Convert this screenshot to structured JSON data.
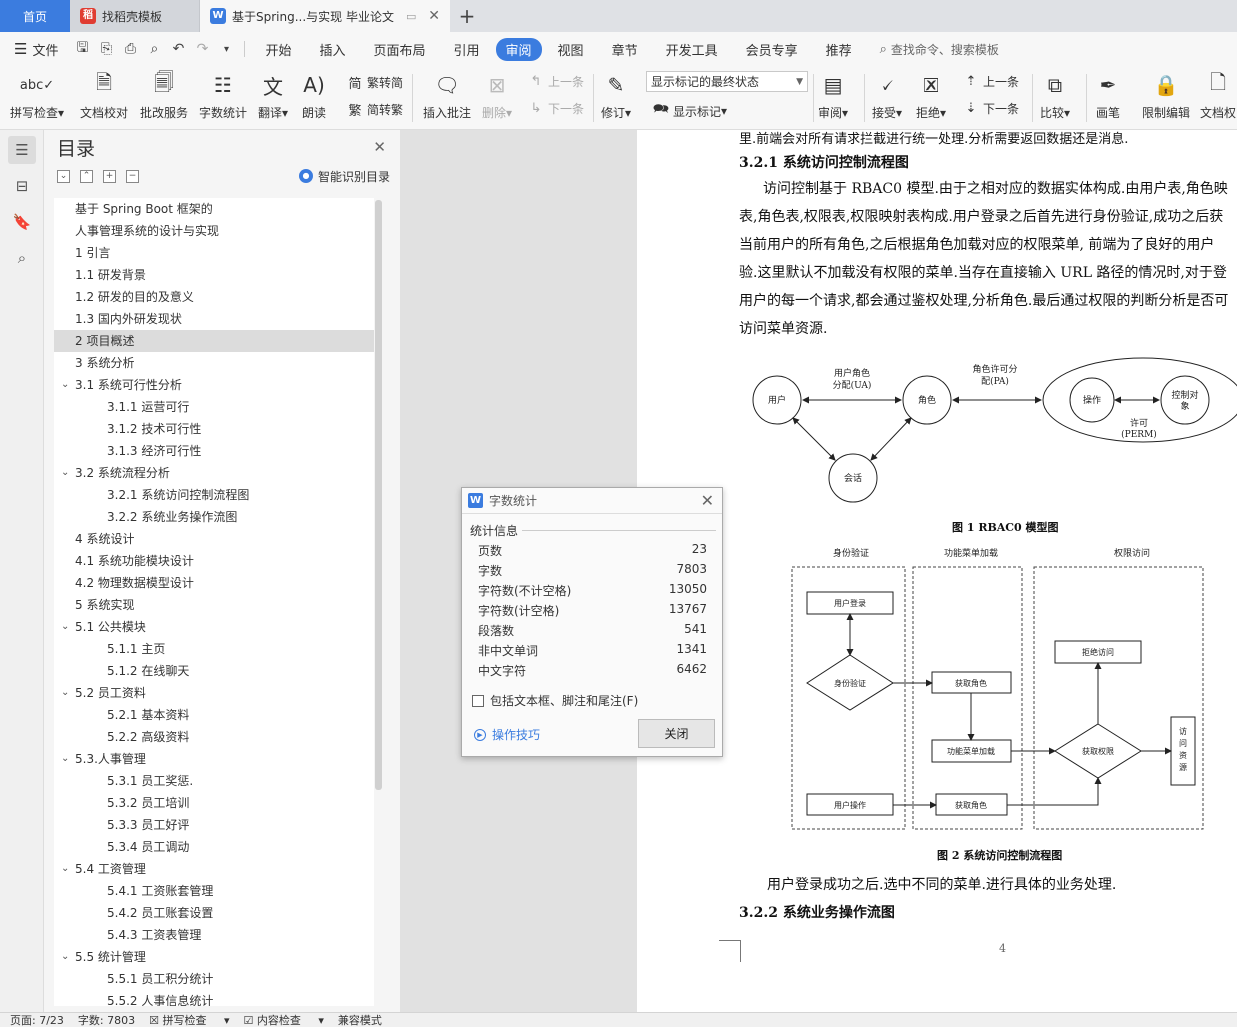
{
  "tabs": {
    "home": "首页",
    "template": "找稻壳模板",
    "active": "基于Spring...与实现 毕业论文",
    "new_tab": "+"
  },
  "menu": {
    "file": "文件",
    "items": [
      "开始",
      "插入",
      "页面布局",
      "引用",
      "审阅",
      "视图",
      "章节",
      "开发工具",
      "会员专享",
      "推荐"
    ],
    "active_index": 4,
    "search": "查找命令、搜索模板"
  },
  "ribbon": {
    "spell_check": "拼写检查",
    "doc_proof": "文档校对",
    "batch_service": "批改服务",
    "word_count": "字数统计",
    "translate": "翻译",
    "read_aloud": "朗读",
    "trad_to_simp": "繁转简",
    "simp_to_trad": "简转繁",
    "insert_comment": "插入批注",
    "delete": "删除",
    "prev_comment": "上一条",
    "next_comment": "下一条",
    "track_changes": "修订",
    "markup_state": "显示标记的最终状态",
    "show_markup": "显示标记",
    "review": "审阅",
    "accept": "接受",
    "reject": "拒绝",
    "prev": "上一条",
    "next": "下一条",
    "compare": "比较",
    "ink": "画笔",
    "restrict_edit": "限制编辑",
    "doc_perm": "文档权"
  },
  "nav": {
    "title": "目录",
    "smart": "智能识别目录",
    "selected_index": 6,
    "items": [
      {
        "label": "基于 Spring Boot 框架的",
        "level": 0,
        "chev": ""
      },
      {
        "label": "人事管理系统的设计与实现",
        "level": 0,
        "chev": ""
      },
      {
        "label": "1 引言",
        "level": 0,
        "chev": ""
      },
      {
        "label": "1.1 研发背景",
        "level": 0,
        "chev": ""
      },
      {
        "label": "1.2 研发的目的及意义",
        "level": 0,
        "chev": ""
      },
      {
        "label": "1.3 国内外研发现状",
        "level": 0,
        "chev": ""
      },
      {
        "label": "2 项目概述",
        "level": 0,
        "chev": ""
      },
      {
        "label": "3 系统分析",
        "level": 0,
        "chev": ""
      },
      {
        "label": "3.1 系统可行性分析",
        "level": 0,
        "chev": "v"
      },
      {
        "label": "3.1.1 运营可行",
        "level": 1,
        "chev": ""
      },
      {
        "label": "3.1.2 技术可行性",
        "level": 1,
        "chev": ""
      },
      {
        "label": "3.1.3 经济可行性",
        "level": 1,
        "chev": ""
      },
      {
        "label": "3.2 系统流程分析",
        "level": 0,
        "chev": "v"
      },
      {
        "label": "3.2.1 系统访问控制流程图",
        "level": 1,
        "chev": ""
      },
      {
        "label": "3.2.2 系统业务操作流图",
        "level": 1,
        "chev": ""
      },
      {
        "label": "4 系统设计",
        "level": 0,
        "chev": ""
      },
      {
        "label": "4.1 系统功能模块设计",
        "level": 0,
        "chev": ""
      },
      {
        "label": "4.2 物理数据模型设计",
        "level": 0,
        "chev": ""
      },
      {
        "label": "5 系统实现",
        "level": 0,
        "chev": ""
      },
      {
        "label": "5.1  公共模块",
        "level": 0,
        "chev": "v"
      },
      {
        "label": "5.1.1 主页",
        "level": 1,
        "chev": ""
      },
      {
        "label": "5.1.2 在线聊天",
        "level": 1,
        "chev": ""
      },
      {
        "label": "5.2  员工资料",
        "level": 0,
        "chev": "v"
      },
      {
        "label": "5.2.1 基本资料",
        "level": 1,
        "chev": ""
      },
      {
        "label": "5.2.2  高级资料",
        "level": 1,
        "chev": ""
      },
      {
        "label": "5.3.人事管理",
        "level": 0,
        "chev": "v"
      },
      {
        "label": "5.3.1 员工奖惩.",
        "level": 1,
        "chev": ""
      },
      {
        "label": "5.3.2 员工培训",
        "level": 1,
        "chev": ""
      },
      {
        "label": "5.3.3 员工好评",
        "level": 1,
        "chev": ""
      },
      {
        "label": "5.3.4 员工调动",
        "level": 1,
        "chev": ""
      },
      {
        "label": "5.4 工资管理",
        "level": 0,
        "chev": "v"
      },
      {
        "label": "5.4.1 工资账套管理",
        "level": 1,
        "chev": ""
      },
      {
        "label": "5.4.2 员工账套设置",
        "level": 1,
        "chev": ""
      },
      {
        "label": "5.4.3 工资表管理",
        "level": 1,
        "chev": ""
      },
      {
        "label": "5.5 统计管理",
        "level": 0,
        "chev": "v"
      },
      {
        "label": "5.5.1 员工积分统计",
        "level": 1,
        "chev": ""
      },
      {
        "label": "5.5.2 人事信息统计",
        "level": 1,
        "chev": ""
      }
    ]
  },
  "dialog": {
    "title": "字数统计",
    "section": "统计信息",
    "stats": [
      {
        "label": "页数",
        "value": "23"
      },
      {
        "label": "字数",
        "value": "7803"
      },
      {
        "label": "字符数(不计空格)",
        "value": "13050"
      },
      {
        "label": "字符数(计空格)",
        "value": "13767"
      },
      {
        "label": "段落数",
        "value": "541"
      },
      {
        "label": "非中文单词",
        "value": "1341"
      },
      {
        "label": "中文字符",
        "value": "6462"
      }
    ],
    "include_label": "包括文本框、脚注和尾注(F)",
    "include_checked": false,
    "tips": "操作技巧",
    "close": "关闭"
  },
  "doc": {
    "top_line": "里.前端会对所有请求拦截进行统一处理.分析需要返回数据还是消息.",
    "heading_321": "3.2.1 系统访问控制流程图",
    "para1_lines": [
      "访问控制基于 RBAC0 模型.由于之相对应的数据实体构成.由用户表,角色映",
      "表,角色表,权限表,权限映射表构成.用户登录之后首先进行身份验证,成功之后获",
      "当前用户的所有角色,之后根据角色加载对应的权限菜单, 前端为了良好的用户",
      "验.这里默认不加载没有权限的菜单.当存在直接输入 URL 路径的情况时,对于登",
      "用户的每一个请求,都会通过鉴权处理,分析角色.最后通过权限的判断分析是否可",
      "访问菜单资源."
    ],
    "fig1": {
      "caption": "图 1 RBAC0 模型图",
      "user": "用户",
      "role": "角色",
      "session": "会话",
      "ua_line1": "用户角色",
      "ua_line2": "分配(UA)",
      "pa_line1": "角色许可分",
      "pa_line2": "配(PA)",
      "operation": "操作",
      "control_line1": "控制对",
      "control_line2": "象",
      "perm_line1": "许可",
      "perm_line2": "(PERM)"
    },
    "fig2": {
      "caption": "图 2  系统访问控制流程图",
      "col1": "身份验证",
      "col2": "功能菜单加载",
      "col3": "权限访问",
      "user_login": "用户登录",
      "auth": "身份验证",
      "get_role": "获取角色",
      "load_menu": "功能菜单加载",
      "user_op": "用户操作",
      "get_role2": "获取角色",
      "deny": "拒绝访问",
      "get_perm": "获取权限",
      "access": [
        "访",
        "问",
        "资",
        "源"
      ]
    },
    "para2": "用户登录成功之后.选中不同的菜单.进行具体的业务处理.",
    "heading_322": "3.2.2 系统业务操作流图",
    "page_number": "4"
  },
  "status": {
    "page": "页面: 7/23",
    "words": "字数: 7803",
    "spell": "拼写检查",
    "content_check": "内容检查",
    "compat": "兼容模式"
  },
  "colors": {
    "accent": "#3b7cdf",
    "tabbar": "#dfe1e5",
    "ribbon": "#f7f7f7",
    "desk": "#e1e1e1"
  }
}
